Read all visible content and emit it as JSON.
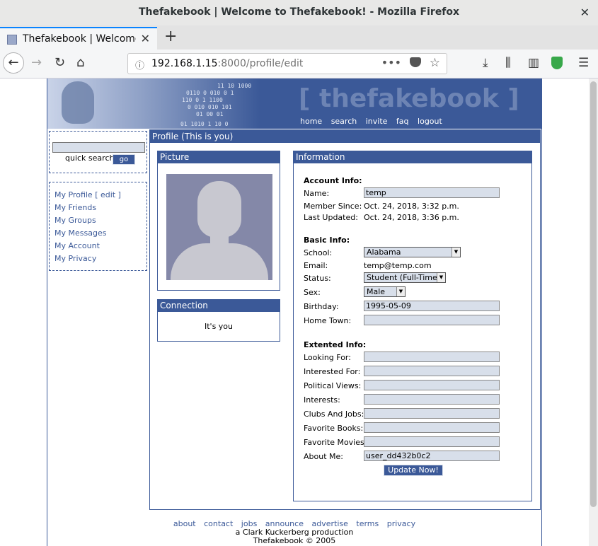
{
  "window": {
    "title": "Thefakebook | Welcome to Thefakebook! - Mozilla Firefox"
  },
  "tab": {
    "title": "Thefakebook | Welcome to Thefakebook!"
  },
  "urlbar": {
    "host": "192.168.1.15",
    "rest": ":8000/profile/edit"
  },
  "banner": {
    "logo": "[ thefakebook ]",
    "nav": [
      "home",
      "search",
      "invite",
      "faq",
      "logout"
    ],
    "binary": [
      "11   10    1000",
      "0110  0 010   0  1",
      "110   0   1    1100",
      "0 010  010   101",
      "01   00   01",
      "01   1010    1  10  0"
    ]
  },
  "sidebar": {
    "quick_search_label": "quick search",
    "go_label": "go",
    "links": [
      "My Profile [ edit ]",
      "My Friends",
      "My Groups",
      "My Messages",
      "My Account",
      "My Privacy"
    ]
  },
  "main": {
    "header": "Profile (This is you)",
    "picture_title": "Picture",
    "connection_title": "Connection",
    "connection_text": "It's you",
    "info_title": "Information",
    "account_info": "Account Info:",
    "name_label": "Name:",
    "name_value": "temp",
    "member_since_label": "Member Since:",
    "member_since_value": "Oct. 24, 2018, 3:32 p.m.",
    "last_updated_label": "Last Updated:",
    "last_updated_value": "Oct. 24, 2018, 3:36 p.m.",
    "basic_info": "Basic Info:",
    "school_label": "School:",
    "school_value": "Alabama",
    "email_label": "Email:",
    "email_value": "temp@temp.com",
    "status_label": "Status:",
    "status_value": "Student (Full-Time)",
    "sex_label": "Sex:",
    "sex_value": "Male",
    "birthday_label": "Birthday:",
    "birthday_value": "1995-05-09",
    "hometown_label": "Home Town:",
    "hometown_value": "",
    "extended_info": "Extented Info:",
    "extended_fields": [
      {
        "label": "Looking For:",
        "value": ""
      },
      {
        "label": "Interested For:",
        "value": ""
      },
      {
        "label": "Political Views:",
        "value": ""
      },
      {
        "label": "Interests:",
        "value": ""
      },
      {
        "label": "Clubs And Jobs:",
        "value": ""
      },
      {
        "label": "Favorite Books:",
        "value": ""
      },
      {
        "label": "Favorite Movies:",
        "value": ""
      },
      {
        "label": "About Me:",
        "value": "user_dd432b0c2"
      }
    ],
    "update_button": "Update Now!"
  },
  "footer": {
    "links": [
      "about",
      "contact",
      "jobs",
      "announce",
      "advertise",
      "terms",
      "privacy"
    ],
    "credit": "a Clark Kuckerberg production",
    "copyright": "Thefakebook © 2005"
  },
  "colors": {
    "brand": "#3b5998",
    "input_bg": "#d8dfea"
  },
  "icons": [
    "back-icon",
    "forward-icon",
    "reload-icon",
    "home-icon",
    "info-icon",
    "page-actions-icon",
    "pocket-icon",
    "bookmark-star-icon",
    "downloads-icon",
    "library-icon",
    "sidebar-icon",
    "shield-icon",
    "menu-icon"
  ]
}
